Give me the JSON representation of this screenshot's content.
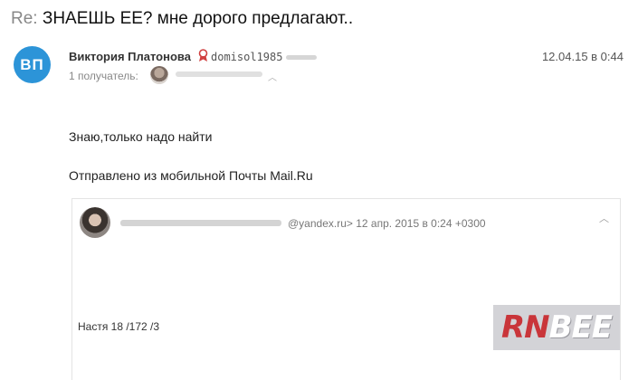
{
  "subject": {
    "prefix": "Re:",
    "text": "ЗНАЕШЬ ЕЕ? мне дорого предлагают.."
  },
  "message": {
    "avatar_initials": "ВП",
    "sender_name": "Виктория Платонова",
    "sender_email": "domisol1985",
    "date": "12.04.15 в 0:44",
    "recipients_label": "1 получатель:",
    "body": [
      "Знаю,только надо найти",
      "Отправлено из мобильной Почты Mail.Ru"
    ]
  },
  "quoted": {
    "meta": "@yandex.ru>  12 апр. 2015 в 0:24 +0300",
    "body": "Настя 18 /172 /3"
  },
  "watermark": {
    "rn": "RN",
    "bee": "BEE"
  },
  "colors": {
    "avatar": "#2c94d8",
    "watermark_rn": "#c9353a"
  }
}
